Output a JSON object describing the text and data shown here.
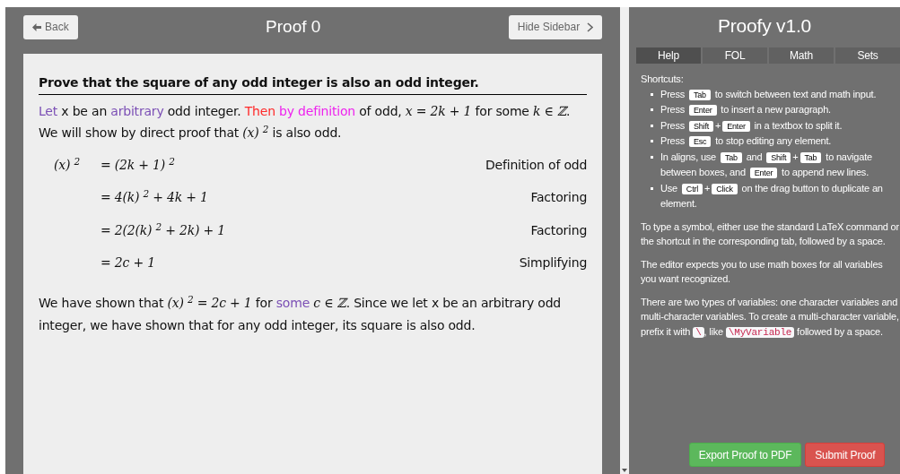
{
  "header": {
    "back_button": "Back",
    "title": "Proof 0",
    "sidebar_button": "Hide Sidebar"
  },
  "proof": {
    "heading": "Prove that the square of any odd integer is also an odd integer.",
    "intro": [
      {
        "kind": "text",
        "text": "Let",
        "color": "#7b4fb5"
      },
      {
        "kind": "text",
        "text": " x be an "
      },
      {
        "kind": "text",
        "text": "arbitrary",
        "color": "#7b4fb5"
      },
      {
        "kind": "text",
        "text": " odd integer. "
      },
      {
        "kind": "text",
        "text": "Then ",
        "color": "#ff2a2a"
      },
      {
        "kind": "text",
        "text": "by definition",
        "color": "#ee22ee"
      },
      {
        "kind": "text",
        "text": " of odd, "
      },
      {
        "kind": "math",
        "text": "x = 2k + 1"
      },
      {
        "kind": "text",
        "text": " for some "
      },
      {
        "kind": "math",
        "text": "k ∈ ℤ"
      },
      {
        "kind": "text",
        "text": ". We will show by direct proof that "
      },
      {
        "kind": "math",
        "text": "(x) $^{2}$"
      },
      {
        "kind": "text",
        "text": " is also odd."
      }
    ],
    "steps": [
      {
        "lhs": "(x) $^{2}$",
        "rhs": "= (2k + 1) $^{2}$",
        "reason": "Definition of odd"
      },
      {
        "rhs": "= 4(k) $^{2}$ + 4k + 1",
        "reason": "Factoring"
      },
      {
        "rhs": "= 2(2(k) $^{2}$ + 2k) + 1",
        "reason": "Factoring"
      },
      {
        "rhs": "= 2c + 1",
        "reason": "Simplifying"
      }
    ],
    "conclusion": [
      {
        "kind": "text",
        "text": "We have shown that "
      },
      {
        "kind": "math",
        "text": "(x) $^{2}$ = 2c + 1"
      },
      {
        "kind": "text",
        "text": " for "
      },
      {
        "kind": "text",
        "text": "some ",
        "color": "#7b4fb5"
      },
      {
        "kind": "math",
        "text": "c ∈ ℤ"
      },
      {
        "kind": "text",
        "text": ". Since we let x be an arbitrary odd integer, we have shown that for any odd integer, its square is also odd."
      }
    ]
  },
  "sidebar": {
    "title": "Proofy v1.0",
    "tabs": [
      {
        "label": "Help",
        "selected": true
      },
      {
        "label": "FOL",
        "selected": false
      },
      {
        "label": "Math",
        "selected": false
      },
      {
        "label": "Sets",
        "selected": false
      }
    ],
    "shortcuts_label": "Shortcuts:",
    "shortcuts": [
      [
        {
          "kind": "text",
          "text": "Press "
        },
        {
          "kind": "key",
          "text": "Tab"
        },
        {
          "kind": "text",
          "text": " to switch between text and math input."
        }
      ],
      [
        {
          "kind": "text",
          "text": "Press "
        },
        {
          "kind": "key",
          "text": "Enter"
        },
        {
          "kind": "text",
          "text": " to insert a new paragraph."
        }
      ],
      [
        {
          "kind": "text",
          "text": "Press "
        },
        {
          "kind": "key",
          "text": "Shift"
        },
        {
          "kind": "text",
          "text": "+"
        },
        {
          "kind": "key",
          "text": "Enter"
        },
        {
          "kind": "text",
          "text": " in a textbox to split it."
        }
      ],
      [
        {
          "kind": "text",
          "text": "Press "
        },
        {
          "kind": "key",
          "text": "Esc"
        },
        {
          "kind": "text",
          "text": " to stop editing any element."
        }
      ],
      [
        {
          "kind": "text",
          "text": "In aligns, use "
        },
        {
          "kind": "key",
          "text": "Tab"
        },
        {
          "kind": "text",
          "text": " and "
        },
        {
          "kind": "key",
          "text": "Shift"
        },
        {
          "kind": "text",
          "text": "+"
        },
        {
          "kind": "key",
          "text": "Tab"
        },
        {
          "kind": "text",
          "text": " to navigate between boxes, and "
        },
        {
          "kind": "key",
          "text": "Enter"
        },
        {
          "kind": "text",
          "text": " to append new lines."
        }
      ],
      [
        {
          "kind": "text",
          "text": "Use "
        },
        {
          "kind": "key",
          "text": "Ctrl"
        },
        {
          "kind": "text",
          "text": "+"
        },
        {
          "kind": "key",
          "text": "Click"
        },
        {
          "kind": "text",
          "text": " on the drag button to duplicate an element."
        }
      ]
    ],
    "paragraphs": [
      [
        {
          "kind": "text",
          "text": "To type a symbol, either use the standard LaTeX command or the shortcut in the corresponding tab, followed by a space."
        }
      ],
      [
        {
          "kind": "text",
          "text": "The editor expects you to use math boxes for all variables you want recognized."
        }
      ],
      [
        {
          "kind": "text",
          "text": "There are two types of variables: one character variables and multi-character variables. To create a multi-character variable, prefix it with "
        },
        {
          "kind": "code",
          "text": "\\"
        },
        {
          "kind": "text",
          "text": ", like "
        },
        {
          "kind": "code",
          "text": "\\MyVariable"
        },
        {
          "kind": "text",
          "text": " followed by a space."
        }
      ]
    ],
    "export_button": "Export Proof to PDF",
    "submit_button": "Submit Proof"
  }
}
